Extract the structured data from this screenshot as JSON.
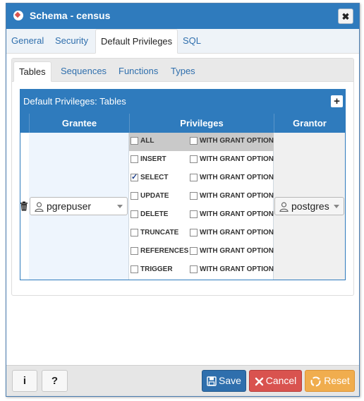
{
  "dialog": {
    "title": "Schema - census",
    "close_label": "✖"
  },
  "tabs": [
    "General",
    "Security",
    "Default Privileges",
    "SQL"
  ],
  "active_tab": "Default Privileges",
  "subtabs": [
    "Tables",
    "Sequences",
    "Functions",
    "Types"
  ],
  "active_subtab": "Tables",
  "grid": {
    "title": "Default Privileges: Tables",
    "add_label": "+",
    "columns": [
      "Grantee",
      "Privileges",
      "Grantor"
    ],
    "row": {
      "grantee": "pgrepuser",
      "grantor": "postgres",
      "privileges": [
        {
          "name": "ALL",
          "checked": false,
          "grant_option_label": "WITH GRANT OPTION",
          "grant_checked": false
        },
        {
          "name": "INSERT",
          "checked": false,
          "grant_option_label": "WITH GRANT OPTION",
          "grant_checked": false
        },
        {
          "name": "SELECT",
          "checked": true,
          "grant_option_label": "WITH GRANT OPTION",
          "grant_checked": false
        },
        {
          "name": "UPDATE",
          "checked": false,
          "grant_option_label": "WITH GRANT OPTION",
          "grant_checked": false
        },
        {
          "name": "DELETE",
          "checked": false,
          "grant_option_label": "WITH GRANT OPTION",
          "grant_checked": false
        },
        {
          "name": "TRUNCATE",
          "checked": false,
          "grant_option_label": "WITH GRANT OPTION",
          "grant_checked": false
        },
        {
          "name": "REFERENCES",
          "checked": false,
          "grant_option_label": "WITH GRANT OPTION",
          "grant_checked": false
        },
        {
          "name": "TRIGGER",
          "checked": false,
          "grant_option_label": "WITH GRANT OPTION",
          "grant_checked": false
        }
      ]
    }
  },
  "footer": {
    "info_label": "i",
    "help_label": "?",
    "save_label": "Save",
    "cancel_label": "Cancel",
    "reset_label": "Reset"
  },
  "colors": {
    "primary": "#2f7bbd",
    "save": "#2f6fad",
    "cancel": "#d9534f",
    "reset": "#f0ad4e"
  }
}
